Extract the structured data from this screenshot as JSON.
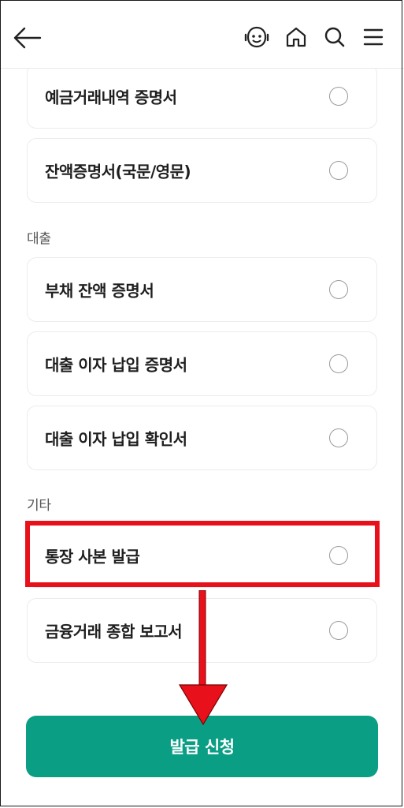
{
  "header": {
    "icons": [
      "back-arrow-icon",
      "chatbot-icon",
      "home-icon",
      "search-icon",
      "menu-icon"
    ]
  },
  "deposit_items": [
    {
      "label": "예금거래내역 증명서",
      "selected": false
    },
    {
      "label": "잔액증명서(국문/영문)",
      "selected": false
    }
  ],
  "sections": {
    "loan": {
      "title": "대출",
      "items": [
        {
          "label": "부채 잔액 증명서",
          "selected": false
        },
        {
          "label": "대출 이자 납입 증명서",
          "selected": false
        },
        {
          "label": "대출 이자 납입 확인서",
          "selected": false
        }
      ]
    },
    "other": {
      "title": "기타",
      "items": [
        {
          "label": "통장 사본 발급",
          "selected": false
        },
        {
          "label": "금융거래 종합 보고서",
          "selected": false
        }
      ]
    }
  },
  "annotation": {
    "highlight_color": "#e8101a"
  },
  "cta": {
    "label": "발급 신청",
    "color": "#0a9e85"
  }
}
